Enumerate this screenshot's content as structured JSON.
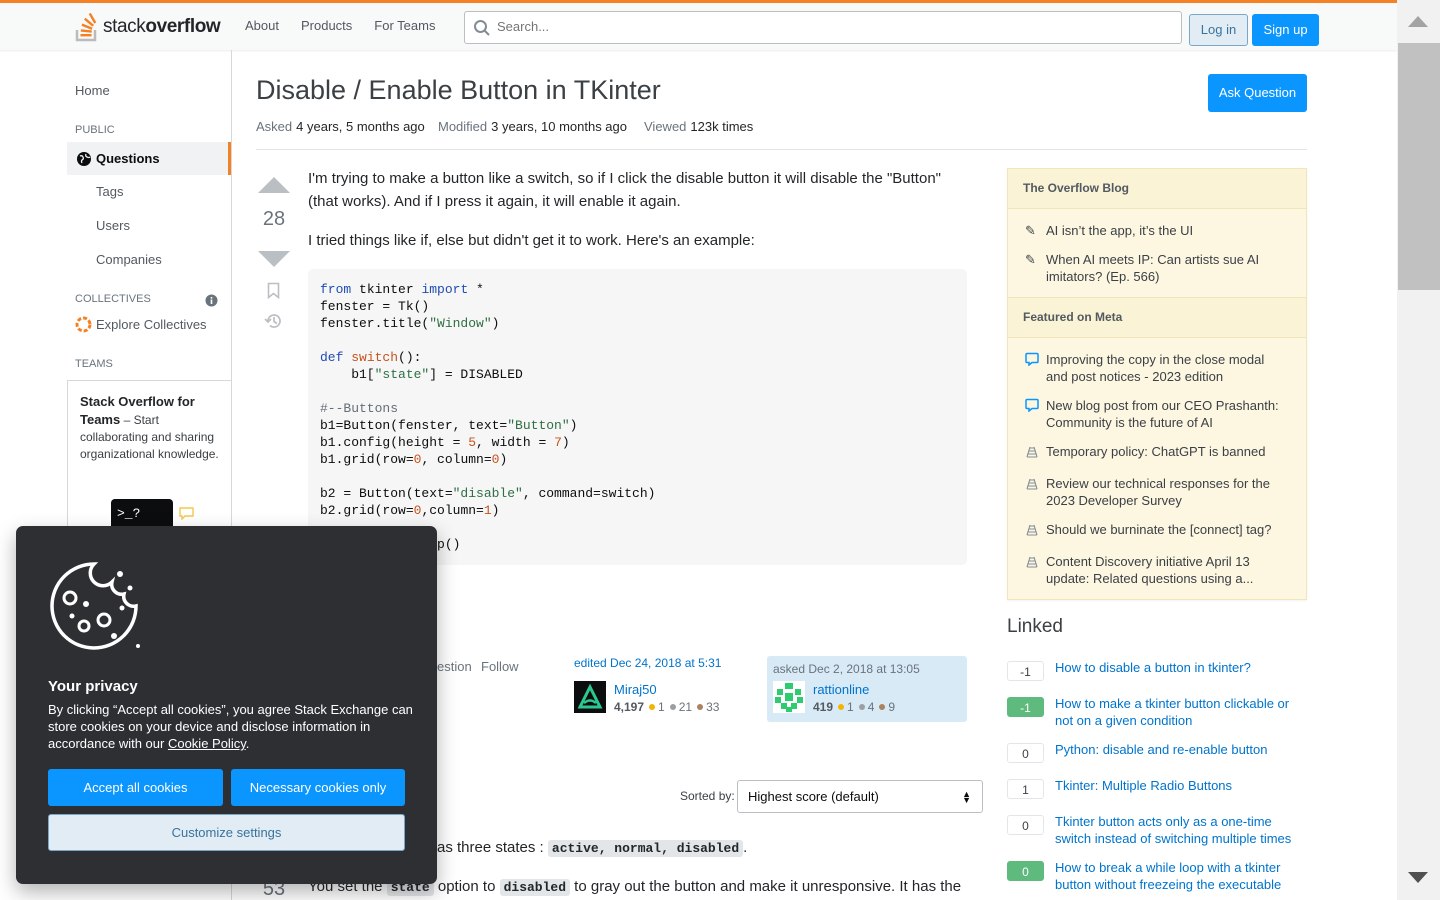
{
  "header": {
    "logo_text_light": "stack",
    "logo_text_bold": "overflow",
    "nav": [
      "About",
      "Products",
      "For Teams"
    ],
    "search_placeholder": "Search...",
    "login": "Log in",
    "signup": "Sign up",
    "accent": "#f48225"
  },
  "sidebar": {
    "home": "Home",
    "public": "PUBLIC",
    "questions": "Questions",
    "tags": "Tags",
    "users": "Users",
    "companies": "Companies",
    "collectives": "COLLECTIVES",
    "explore_collectives": "Explore Collectives",
    "teams": "TEAMS",
    "teams_title": "Stack Overflow for Teams",
    "teams_desc": " – Start collaborating and sharing organizational knowledge.",
    "teams_cta": ">_?"
  },
  "question": {
    "title": "Disable / Enable Button in TKinter",
    "ask_button": "Ask Question",
    "asked_label": "Asked",
    "asked_value": "4 years, 5 months ago",
    "modified_label": "Modified",
    "modified_value": "3 years, 10 months ago",
    "viewed_label": "Viewed",
    "viewed_value": "123k times",
    "votes": "28",
    "body_p1": "I'm trying to make a button like a switch, so if I click the disable button it will disable the \"Button\" (that works). And if I press it again, it will enable it again.",
    "body_p2": "I tried things like if, else but didn't get it to work. Here's an example:",
    "code_tail": "p()",
    "actions_partial": "estion",
    "follow": "Follow",
    "editor": {
      "action": "edited Dec 24, 2018 at 5:31",
      "name": "Miraj50",
      "rep": "4,197",
      "gold": "1",
      "silver": "21",
      "bronze": "33"
    },
    "asker": {
      "action": "asked Dec 2, 2018 at 13:05",
      "name": "rattionline",
      "rep": "419",
      "gold": "1",
      "silver": "4",
      "bronze": "9"
    }
  },
  "answers": {
    "sorted_label": "Sorted by:",
    "sort_value": "Highest score (default)",
    "answer_votes": "53",
    "line1_prefix": "as three states : ",
    "line1_code": "active, normal, disabled",
    "line1_suffix": ".",
    "line2_prefix": "You set the ",
    "line2_code1": "state",
    "line2_mid": " option to ",
    "line2_code2": "disabled",
    "line2_suffix": " to gray out the button and make it unresponsive. It has the"
  },
  "blog": {
    "heading1": "The Overflow Blog",
    "items1": [
      "AI isn’t the app, it’s the UI",
      "When AI meets IP: Can artists sue AI imitators? (Ep. 566)"
    ],
    "heading2": "Featured on Meta",
    "items2": [
      "Improving the copy in the close modal and post notices - 2023 edition",
      "New blog post from our CEO Prashanth: Community is the future of AI",
      "Temporary policy: ChatGPT is banned",
      "Review our technical responses for the 2023 Developer Survey",
      "Should we burninate the [connect] tag?",
      "Content Discovery initiative April 13 update: Related questions using a..."
    ]
  },
  "linked": {
    "title": "Linked",
    "items": [
      {
        "score": "-1",
        "text": "How to disable a button in tkinter?",
        "accepted": false
      },
      {
        "score": "-1",
        "text": "How to make a tkinter button clickable or not on a given condition",
        "accepted": true
      },
      {
        "score": "0",
        "text": "Python: disable and re-enable button",
        "accepted": false
      },
      {
        "score": "1",
        "text": "Tkinter: Multiple Radio Buttons",
        "accepted": false
      },
      {
        "score": "0",
        "text": "Tkinter button acts only as a one-time switch instead of switching multiple times",
        "accepted": false
      },
      {
        "score": "0",
        "text": "How to break a while loop with a tkinter button without freezeing the executable",
        "accepted": true
      }
    ]
  },
  "cookie": {
    "title": "Your privacy",
    "text": "By clicking “Accept all cookies”, you agree Stack Exchange can store cookies on your device and disclose information in accordance with our ",
    "policy_link": "Cookie Policy",
    "text_end": ".",
    "accept_all": "Accept all cookies",
    "necessary_only": "Necessary cookies only",
    "customize": "Customize settings"
  }
}
